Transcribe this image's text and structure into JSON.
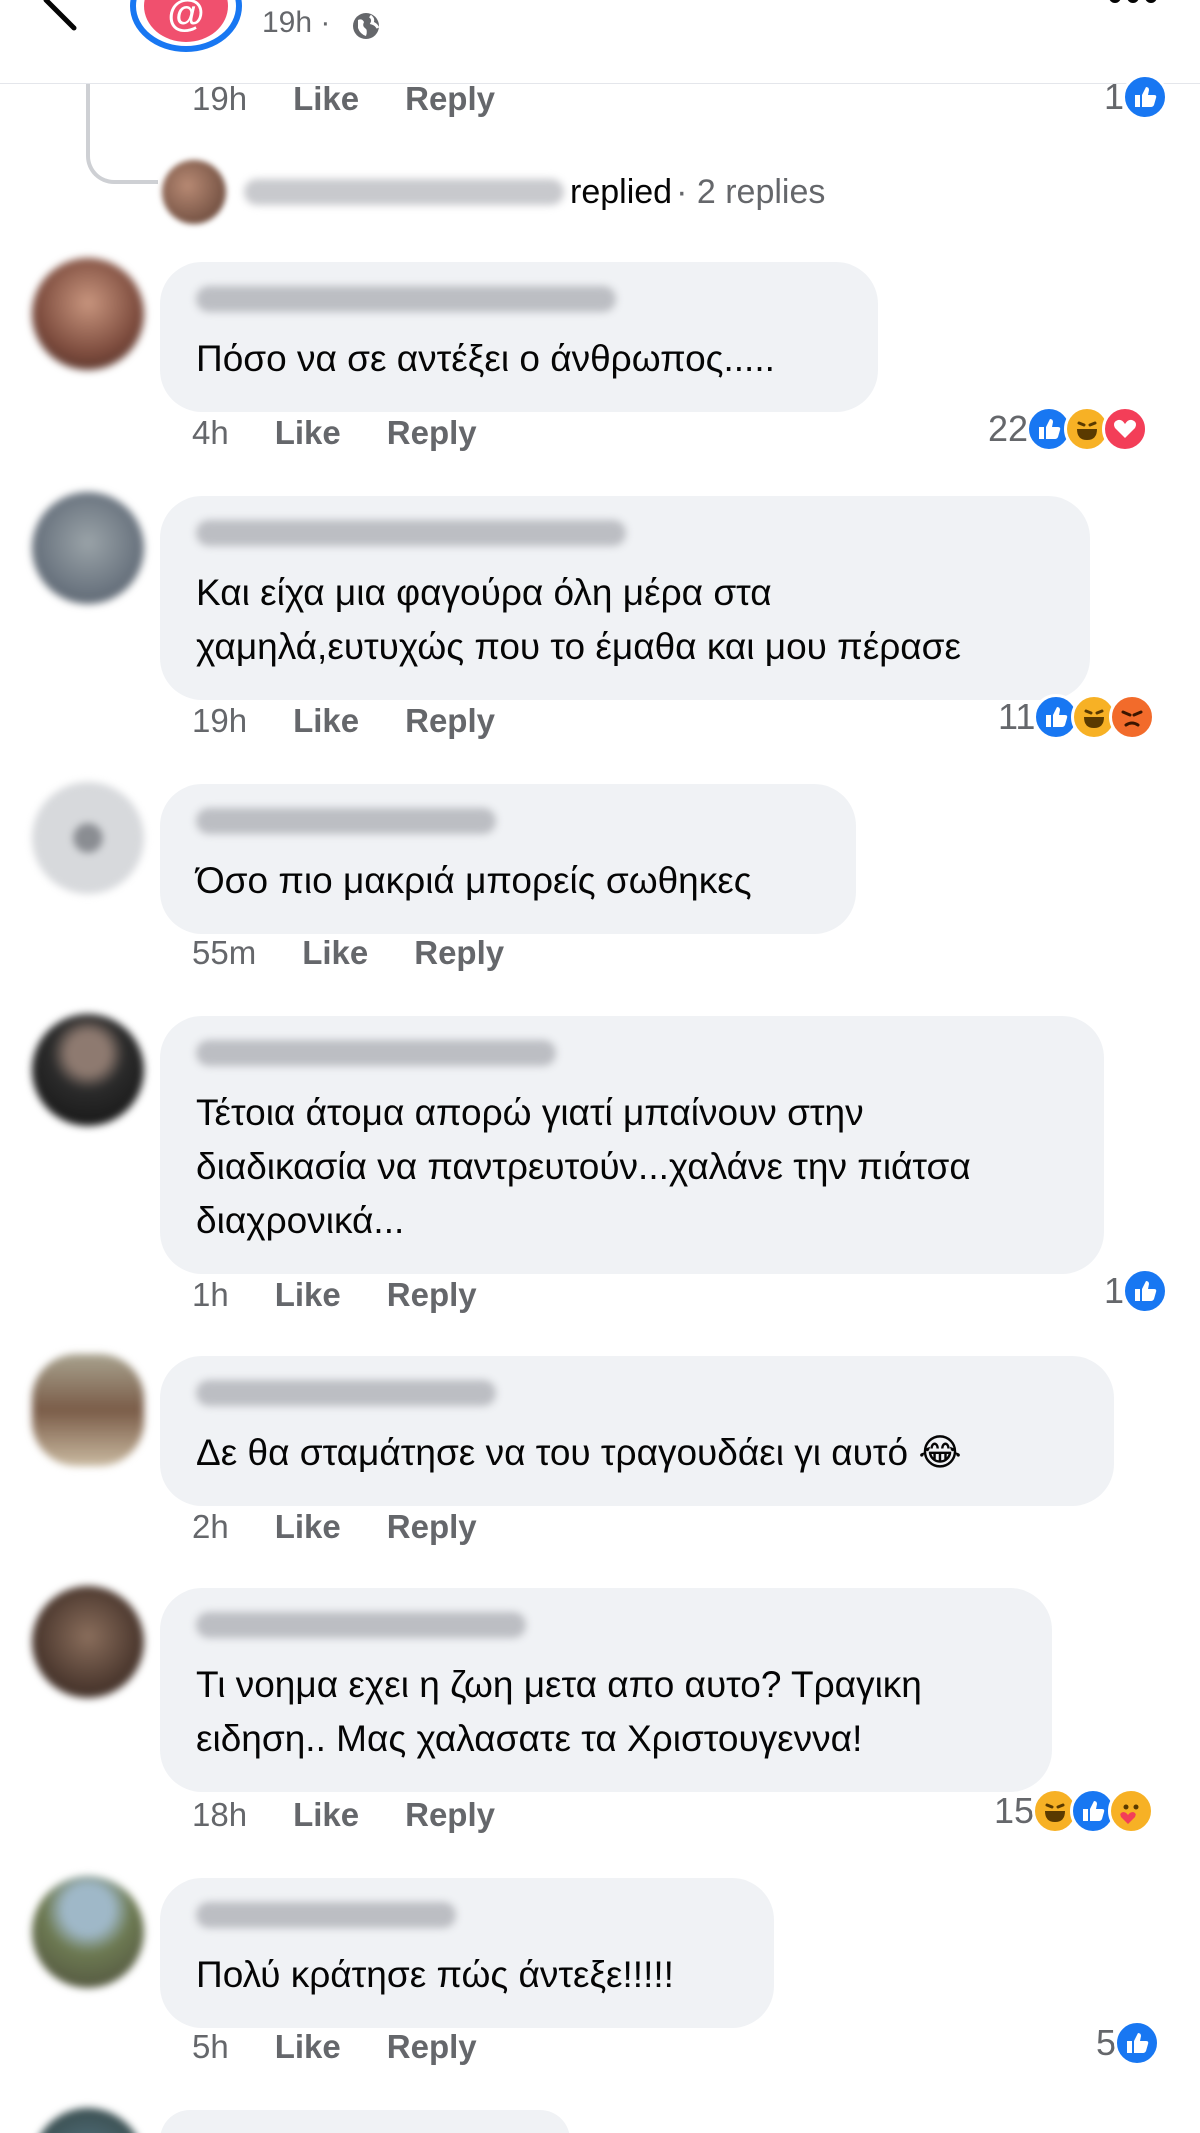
{
  "header": {
    "post_time": "19h",
    "separator": "·",
    "logo_glyph": "@"
  },
  "top_meta": {
    "time": "19h",
    "like": "Like",
    "reply": "Reply",
    "reaction_count": "1"
  },
  "replies": {
    "replied_text": "replied",
    "dot": "·",
    "count_text": "2 replies"
  },
  "comments": [
    {
      "text": "Πόσο να σε αντέξει ο άνθρωπος.....",
      "time": "4h",
      "like": "Like",
      "reply": "Reply",
      "reaction_count": "22",
      "reactions": [
        "like",
        "haha",
        "love"
      ]
    },
    {
      "text": "Και είχα μια φαγούρα όλη μέρα στα\nχαμηλά,ευτυχώς που το έμαθα και μου πέρασε",
      "time": "19h",
      "like": "Like",
      "reply": "Reply",
      "reaction_count": "11",
      "reactions": [
        "like",
        "haha",
        "angry"
      ]
    },
    {
      "text": "Όσο πιο μακριά μπορείς σωθηκες",
      "time": "55m",
      "like": "Like",
      "reply": "Reply",
      "reaction_count": "",
      "reactions": []
    },
    {
      "text": "Τέτοια άτομα απορώ γιατί μπαίνουν στην\nδιαδικασία να παντρευτούν...χαλάνε την πιάτσα\nδιαχρονικά...",
      "time": "1h",
      "like": "Like",
      "reply": "Reply",
      "reaction_count": "1",
      "reactions": [
        "like"
      ]
    },
    {
      "text": "Δε θα σταμάτησε να του τραγουδάει γι αυτό 😂",
      "time": "2h",
      "like": "Like",
      "reply": "Reply",
      "reaction_count": "",
      "reactions": []
    },
    {
      "text": "Τι νοημα εχει η ζωη μετα απο αυτο? Τραγικη\nειδηση.. Μας χαλασατε τα Χριστουγεννα!",
      "time": "18h",
      "like": "Like",
      "reply": "Reply",
      "reaction_count": "15",
      "reactions": [
        "haha",
        "like",
        "care"
      ]
    },
    {
      "text": "Πολύ κράτησε πώς άντεξε!!!!!",
      "time": "5h",
      "like": "Like",
      "reply": "Reply",
      "reaction_count": "5",
      "reactions": [
        "like"
      ]
    }
  ],
  "colors": {
    "like_blue": "#1877f2",
    "bubble_bg": "#f0f2f5",
    "meta_gray": "#65676b",
    "haha_yellow": "#f7b125",
    "love_red": "#f33e58",
    "angry_orange": "#f26b2b"
  },
  "icons": {
    "back": "back-arrow-icon",
    "globe": "globe-icon",
    "more": "more-options-icon",
    "like": "like-reaction-icon",
    "haha": "haha-reaction-icon",
    "love": "love-reaction-icon",
    "angry": "angry-reaction-icon",
    "care": "care-reaction-icon"
  }
}
